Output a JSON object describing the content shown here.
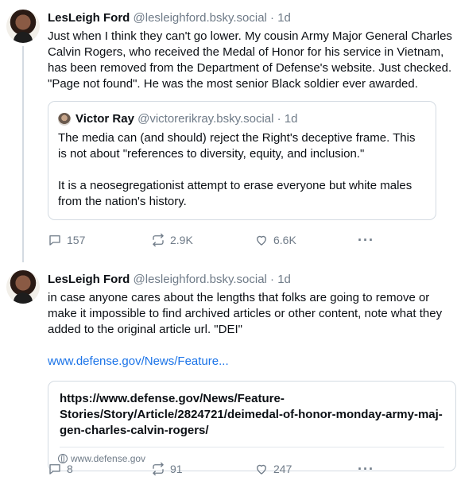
{
  "posts": [
    {
      "author": "LesLeigh Ford",
      "handle": "@lesleighford.bsky.social",
      "separator": "·",
      "time": "1d",
      "text": "Just when I think they can't go lower. My cousin Army Major General Charles Calvin Rogers, who received the Medal of Honor for his service in Vietnam, has been removed from the Department of Defense's website. Just checked. \"Page not found\". He was the most senior Black soldier ever awarded.",
      "quote": {
        "author": "Victor Ray",
        "handle": "@victorerikray.bsky.social",
        "separator": "·",
        "time": "1d",
        "paragraph1": "The media can (and should) reject the Right's deceptive frame. This is not about \"references to diversity, equity, and inclusion.\"",
        "paragraph2": "It is a neosegregationist attempt to erase everyone but white males from the nation's history."
      },
      "replies": "157",
      "reposts": "2.9K",
      "likes": "6.6K"
    },
    {
      "author": "LesLeigh Ford",
      "handle": "@lesleighford.bsky.social",
      "separator": "·",
      "time": "1d",
      "text": "in case anyone cares about the lengths that folks are going to remove or make it impossible to find archived articles or other content, note what they added to the original article url. \"DEI\"",
      "link_text": "www.defense.gov/News/Feature...",
      "card": {
        "title": "https://www.defense.gov/News/Feature-Stories/Story/Article/2824721/deimedal-of-honor-monday-army-maj-gen-charles-calvin-rogers/",
        "domain": "www.defense.gov"
      },
      "replies": "8",
      "reposts": "91",
      "likes": "247"
    }
  ],
  "icons": {
    "reply": "reply-icon",
    "repost": "repost-icon",
    "like": "heart-icon",
    "more": "more-options-icon",
    "globe": "globe-icon"
  },
  "colors": {
    "text": "#0b0f14",
    "muted": "#6f7b88",
    "link": "#1a73e8",
    "border": "#d4dbe2"
  }
}
